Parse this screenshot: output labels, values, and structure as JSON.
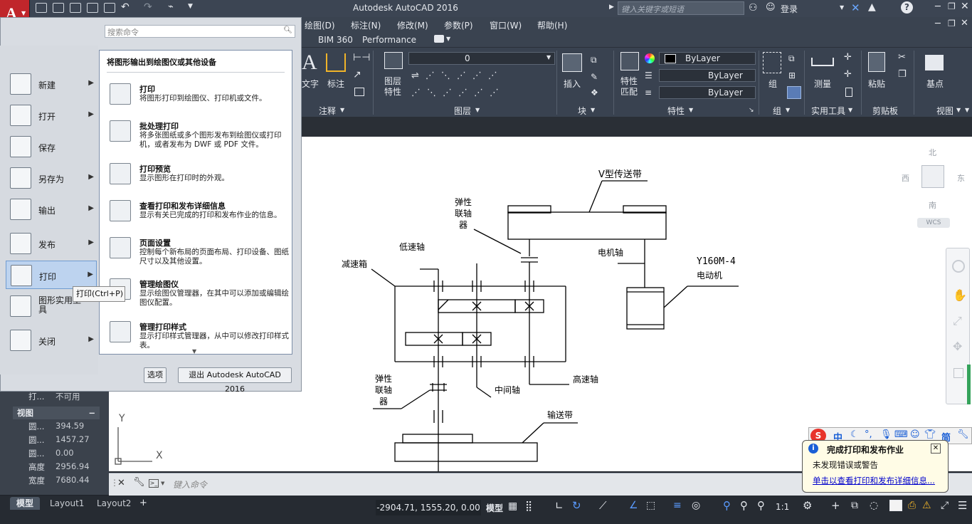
{
  "app": {
    "title": "Autodesk AutoCAD 2016"
  },
  "titlebar": {
    "search_placeholder": "键入关键字或短语",
    "login": "登录"
  },
  "menubar": {
    "items": [
      "绘图(D)",
      "标注(N)",
      "修改(M)",
      "参数(P)",
      "窗口(W)",
      "帮助(H)"
    ]
  },
  "tabs": {
    "items": [
      "BIM 360",
      "Performance"
    ]
  },
  "ribbon": {
    "annotation_labels": [
      "文字",
      "标注"
    ],
    "annotation_panel": "注释",
    "layer_props_label": "图层\n特性",
    "layer_current": "0",
    "layer_panel": "图层",
    "insert_label": "插入",
    "block_panel": "块",
    "match_label": "特性\n匹配",
    "bylayer_color": "ByLayer",
    "bylayer_linetype": "ByLayer",
    "bylayer_lineweight": "ByLayer",
    "properties_panel": "特性",
    "group_label": "组",
    "group_panel": "组",
    "measure_label": "测量",
    "utilities_panel": "实用工具",
    "paste_label": "粘贴",
    "clipboard_panel": "剪贴板",
    "base_label": "基点",
    "view_panel": "视图"
  },
  "appmenu": {
    "search_placeholder": "搜索命令",
    "left_items": [
      {
        "label": "新建",
        "icon": "new-icon"
      },
      {
        "label": "打开",
        "icon": "open-icon"
      },
      {
        "label": "保存",
        "icon": "save-icon"
      },
      {
        "label": "另存为",
        "icon": "save-as-icon"
      },
      {
        "label": "输出",
        "icon": "export-icon"
      },
      {
        "label": "发布",
        "icon": "publish-icon"
      },
      {
        "label": "打印",
        "icon": "print-icon"
      },
      {
        "label": "图形实用工具",
        "icon": "drawing-utilities-icon"
      },
      {
        "label": "关闭",
        "icon": "close-doc-icon"
      }
    ],
    "tooltip": "打印(Ctrl+P)",
    "panel_heading": "将图形输出到绘图仪或其他设备",
    "panel_items": [
      {
        "title": "打印",
        "desc": "将图形打印到绘图仪、打印机或文件。"
      },
      {
        "title": "批处理打印",
        "desc": "将多张图纸或多个图形发布到绘图仪或打印机，或者发布为 DWF 或 PDF 文件。"
      },
      {
        "title": "打印预览",
        "desc": "显示图形在打印时的外观。"
      },
      {
        "title": "查看打印和发布详细信息",
        "desc": "显示有关已完成的打印和发布作业的信息。"
      },
      {
        "title": "页面设置",
        "desc": "控制每个新布局的页面布局、打印设备、图纸尺寸以及其他设置。"
      },
      {
        "title": "管理绘图仪",
        "desc": "显示绘图仪管理器，在其中可以添加或编辑绘图仪配置。"
      },
      {
        "title": "管理打印样式",
        "desc": "显示打印样式管理器，从中可以修改打印样式表。"
      }
    ],
    "options_button": "选项",
    "exit_button": "退出 Autodesk AutoCAD 2016"
  },
  "properties": {
    "print_row": {
      "key": "打...",
      "value": "不可用"
    },
    "section": "视图",
    "rows": [
      {
        "key": "圆...",
        "value": "394.59"
      },
      {
        "key": "圆...",
        "value": "1457.27"
      },
      {
        "key": "圆...",
        "value": "0.00"
      },
      {
        "key": "高度",
        "value": "2956.94"
      },
      {
        "key": "宽度",
        "value": "7680.44"
      }
    ]
  },
  "drawing": {
    "labels": {
      "v_belt": "V型传送带",
      "coupling_top": "弹性\n联轴\n器",
      "low_shaft": "低速轴",
      "reducer": "减速箱",
      "motor_shaft": "电机轴",
      "motor_model": "Y160M-4",
      "motor": "电动机",
      "coupling_bottom": "弹性\n联轴\n器",
      "mid_shaft": "中间轴",
      "high_shaft": "高速轴",
      "conveyor": "输送带"
    }
  },
  "viewcube": {
    "north": "北",
    "south": "南",
    "west": "西",
    "east": "东",
    "wcs": "WCS"
  },
  "ucs": {
    "x": "X",
    "y": "Y"
  },
  "command": {
    "placeholder": "键入命令"
  },
  "statusbar": {
    "tabs": [
      "模型",
      "Layout1",
      "Layout2"
    ],
    "coords": "-2904.71, 1555.20, 0.00",
    "model_btn": "模型",
    "scale": "1:1"
  },
  "notification": {
    "title": "完成打印和发布作业",
    "line1": "未发现错误或警告",
    "link": "单击以查看打印和发布详细信息..."
  },
  "ime": {
    "items": [
      "中",
      "简"
    ]
  }
}
